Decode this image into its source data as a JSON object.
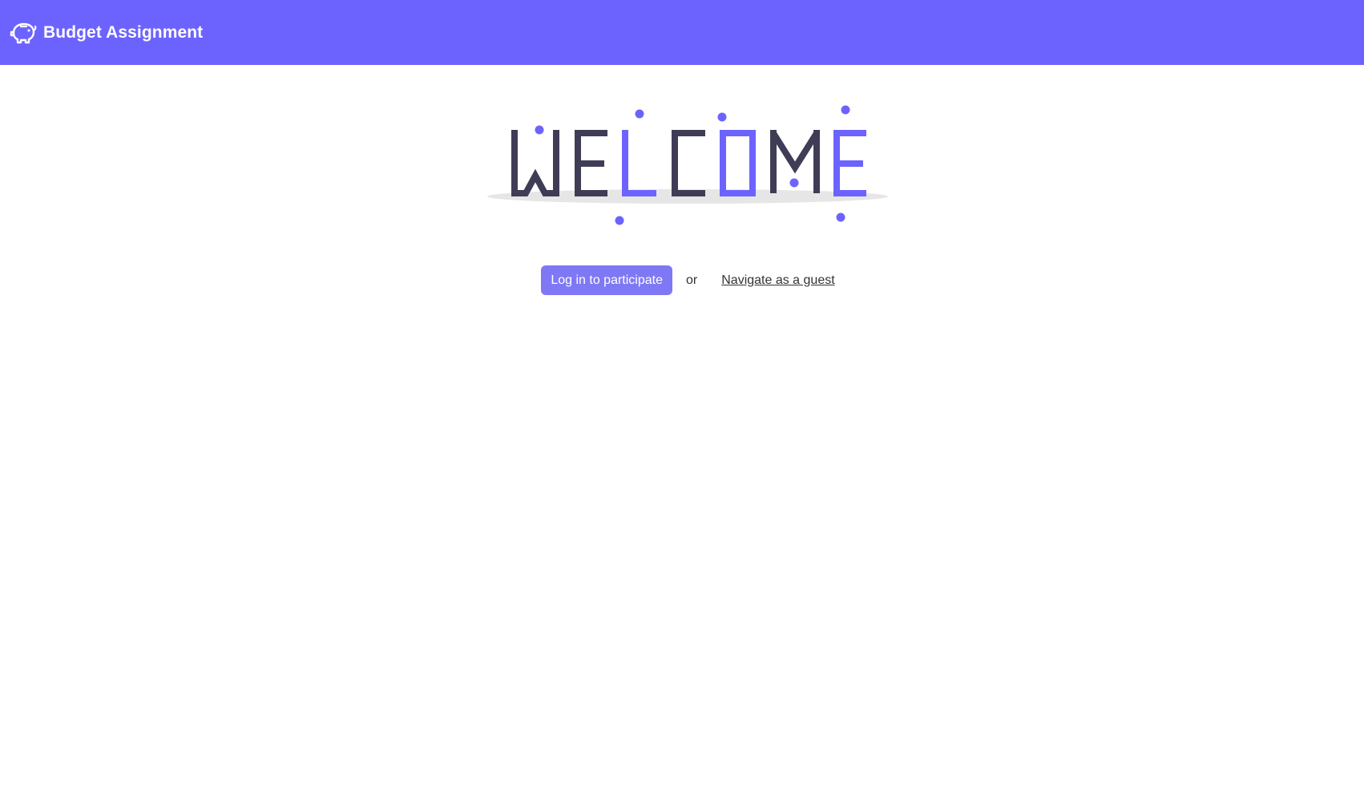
{
  "app": {
    "title": "Budget Assignment",
    "brand_icon": "piggy-bank-icon"
  },
  "colors": {
    "primary": "#6c63ff",
    "button": "#7f78f5",
    "dark_letter": "#3f3d56",
    "accent_letter": "#6c63ff",
    "shadow": "#e6e6e6",
    "text": "#333333"
  },
  "hero": {
    "illustration_text": "WELCOME"
  },
  "actions": {
    "login_label": "Log in to participate",
    "separator": "or",
    "guest_label": "Navigate as a guest"
  }
}
